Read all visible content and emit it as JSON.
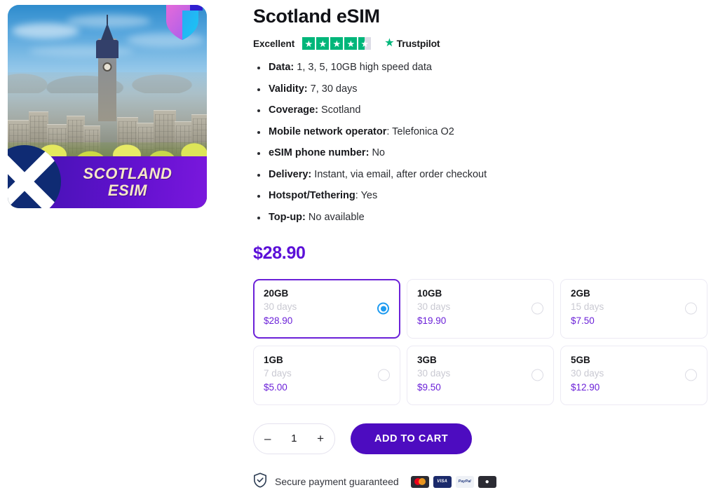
{
  "product": {
    "title": "Scotland eSIM",
    "image": {
      "banner_line1": "SCOTLAND",
      "banner_line2": "ESIM",
      "alt_description": "Edinburgh skyline with Balmoral clock tower"
    }
  },
  "rating": {
    "word": "Excellent",
    "stars_filled": 4,
    "stars_total": 5,
    "half_star": true,
    "brand": "Trustpilot",
    "star_color": "#00b67a"
  },
  "features": [
    {
      "label": "Data:",
      "value": "1, 3, 5, 10GB high speed data"
    },
    {
      "label": "Validity:",
      "value": "7, 30 days"
    },
    {
      "label": "Coverage:",
      "value": "Scotland"
    },
    {
      "label": "Mobile network operator",
      "value": ": Telefonica O2"
    },
    {
      "label": "eSIM phone number:",
      "value": "No"
    },
    {
      "label": "Delivery:",
      "value": "Instant, via email, after order checkout"
    },
    {
      "label": "Hotspot/Tethering",
      "value": ": Yes"
    },
    {
      "label": "Top-up:",
      "value": "No available"
    }
  ],
  "price": {
    "current": "$28.90",
    "accent_color": "#5b10d8"
  },
  "plans": [
    {
      "size": "20GB",
      "days": "30 days",
      "price": "$28.90",
      "selected": true
    },
    {
      "size": "10GB",
      "days": "30 days",
      "price": "$19.90",
      "selected": false
    },
    {
      "size": "2GB",
      "days": "15 days",
      "price": "$7.50",
      "selected": false
    },
    {
      "size": "1GB",
      "days": "7 days",
      "price": "$5.00",
      "selected": false
    },
    {
      "size": "3GB",
      "days": "30 days",
      "price": "$9.50",
      "selected": false
    },
    {
      "size": "5GB",
      "days": "30 days",
      "price": "$12.90",
      "selected": false
    }
  ],
  "cart": {
    "decrease_label": "–",
    "quantity": "1",
    "increase_label": "+",
    "add_to_cart_label": "ADD TO CART",
    "button_color": "#4d0cc0"
  },
  "secure": {
    "text": "Secure payment guaranteed",
    "shield_icon": "shield-check-icon",
    "payment_methods": [
      {
        "name": "mastercard",
        "label": ""
      },
      {
        "name": "visa",
        "label": "VISA"
      },
      {
        "name": "paypal",
        "label": "PayPal"
      },
      {
        "name": "apple-pay",
        "label": ""
      }
    ]
  }
}
